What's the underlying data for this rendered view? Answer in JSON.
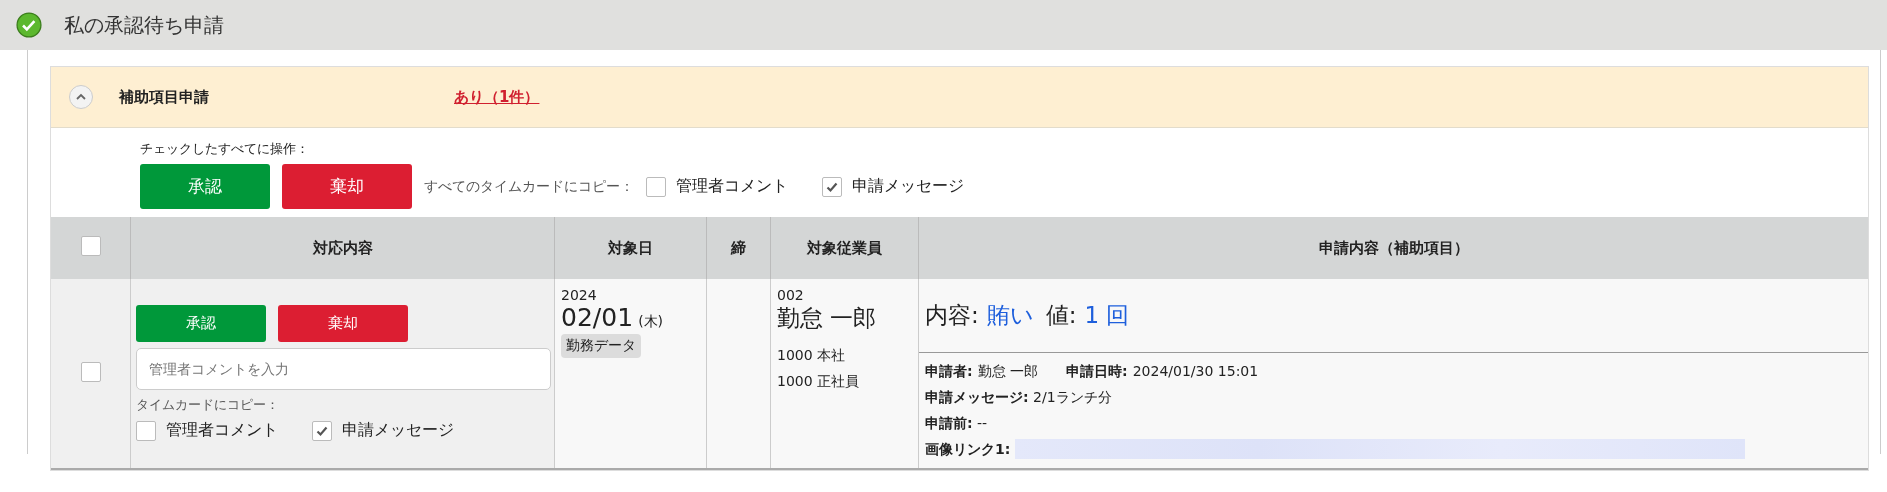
{
  "page_title": "私の承認待ち申請",
  "section": {
    "title": "補助項目申請",
    "status_link": "あり（1件）",
    "expanded": true
  },
  "bulk": {
    "label": "チェックしたすべてに操作：",
    "approve": "承認",
    "reject": "棄却",
    "copy_label": "すべてのタイムカードにコピー：",
    "options": [
      {
        "label": "管理者コメント",
        "checked": false
      },
      {
        "label": "申請メッセージ",
        "checked": true
      }
    ]
  },
  "table": {
    "select_all_checked": false,
    "columns": [
      "対応内容",
      "対象日",
      "締",
      "対象従業員",
      "申請内容（補助項目）"
    ],
    "rows": [
      {
        "checked": false,
        "approve": "承認",
        "reject": "棄却",
        "comment_placeholder": "管理者コメントを入力",
        "copy_label": "タイムカードにコピー：",
        "options": [
          {
            "label": "管理者コメント",
            "checked": false
          },
          {
            "label": "申請メッセージ",
            "checked": true
          }
        ],
        "year": "2024",
        "date": "02/01",
        "weekday": "(木)",
        "tag": "勤務データ",
        "employee_code": "002",
        "employee_name": "勤怠 一郎",
        "org": [
          "1000 本社",
          "1000 正社員"
        ],
        "content": [
          {
            "kind": "label",
            "text": "内容:"
          },
          {
            "kind": "value",
            "text": "賄い"
          },
          {
            "kind": "label",
            "text": "値:"
          },
          {
            "kind": "value",
            "text": "1 回"
          }
        ],
        "details": [
          {
            "label": "申請者:",
            "value": "勤怠 一郎"
          },
          {
            "label": "申請日時:",
            "value": "2024/01/30 15:01"
          }
        ],
        "lines": [
          {
            "kind": "text",
            "text": "**申請メッセージ:** 2/1ランチ分"
          },
          {
            "kind": "text",
            "text": "**申請前:** --"
          },
          {
            "kind": "blurred",
            "label": "画像リンク1:"
          }
        ]
      }
    ]
  }
}
